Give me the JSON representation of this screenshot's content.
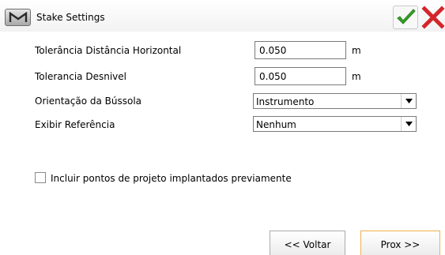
{
  "header": {
    "title": "Stake Settings",
    "menu_icon": "m-logo-icon",
    "ok_icon": "checkmark-icon",
    "cancel_icon": "close-x-icon"
  },
  "form": {
    "horizontal_tolerance": {
      "label": "Tolerância Distância Horizontal",
      "value": "0.050",
      "unit": "m"
    },
    "height_tolerance": {
      "label": "Tolerancia Desnivel",
      "value": "0.050",
      "unit": "m"
    },
    "compass_orientation": {
      "label": "Orientação da Bússola",
      "value": "Instrumento"
    },
    "show_reference": {
      "label": "Exibir Referência",
      "value": "Nenhum"
    },
    "include_staked": {
      "label": "Incluir pontos de projeto implantados previamente",
      "checked": false
    }
  },
  "footer": {
    "back_label": "<< Voltar",
    "next_label": "Prox >>"
  },
  "colors": {
    "check_green": "#3aa12a",
    "cancel_red": "#d3262a",
    "next_border": "#f0b050"
  }
}
